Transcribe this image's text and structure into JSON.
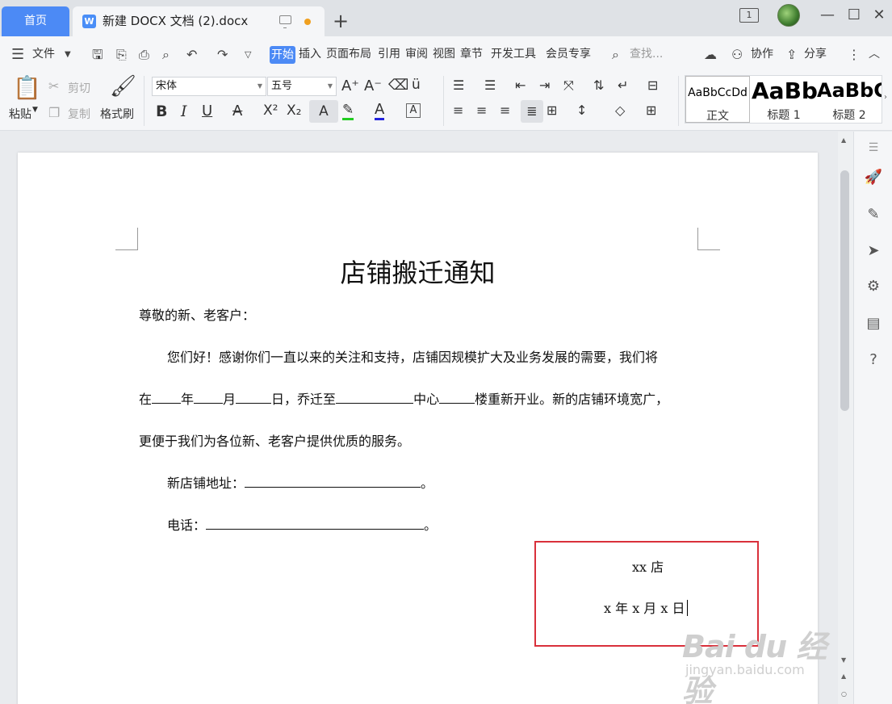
{
  "tabs": {
    "home": "首页",
    "doc_title": "新建 DOCX 文档 (2).docx",
    "doc_icon": "W"
  },
  "window": {
    "window_count": "1",
    "minimize": "—",
    "maximize": "☐",
    "close": "✕"
  },
  "menu": {
    "file": "文件",
    "items": [
      "开始",
      "插入",
      "页面布局",
      "引用",
      "审阅",
      "视图",
      "章节",
      "开发工具",
      "会员专享"
    ],
    "search_placeholder": "查找...",
    "collaborate": "协作",
    "share": "分享"
  },
  "ribbon": {
    "paste": "粘贴",
    "cut": "剪切",
    "copy": "复制",
    "format_painter": "格式刷",
    "font_name": "宋体",
    "font_size": "五号",
    "styles": [
      {
        "sample": "AaBbCcDd",
        "name": "正文"
      },
      {
        "sample": "AaBb",
        "name": "标题 1"
      },
      {
        "sample": "AaBbC",
        "name": "标题 2"
      }
    ]
  },
  "document": {
    "title": "店铺搬迁通知",
    "greeting": "尊敬的新、老客户：",
    "p1": "您们好！感谢你们一直以来的关注和支持，店铺因规模扩大及业务发展的需要，我们将",
    "p2_parts": [
      "在",
      "年",
      "月",
      "日，乔迁至",
      "中心",
      "楼重新开业。新的店铺环境宽广，"
    ],
    "p3": "更便于我们为各位新、老客户提供优质的服务。",
    "address_label": "新店铺地址：",
    "phone_label": "电话：",
    "period": "。",
    "signature": "xx 店",
    "date": "x 年 x 月 x 日"
  },
  "watermark": {
    "logo": "Bai du 经验",
    "url": "jingyan.baidu.com"
  },
  "colors": {
    "accent": "#4c8af5",
    "highlight_box": "#d9303b"
  }
}
